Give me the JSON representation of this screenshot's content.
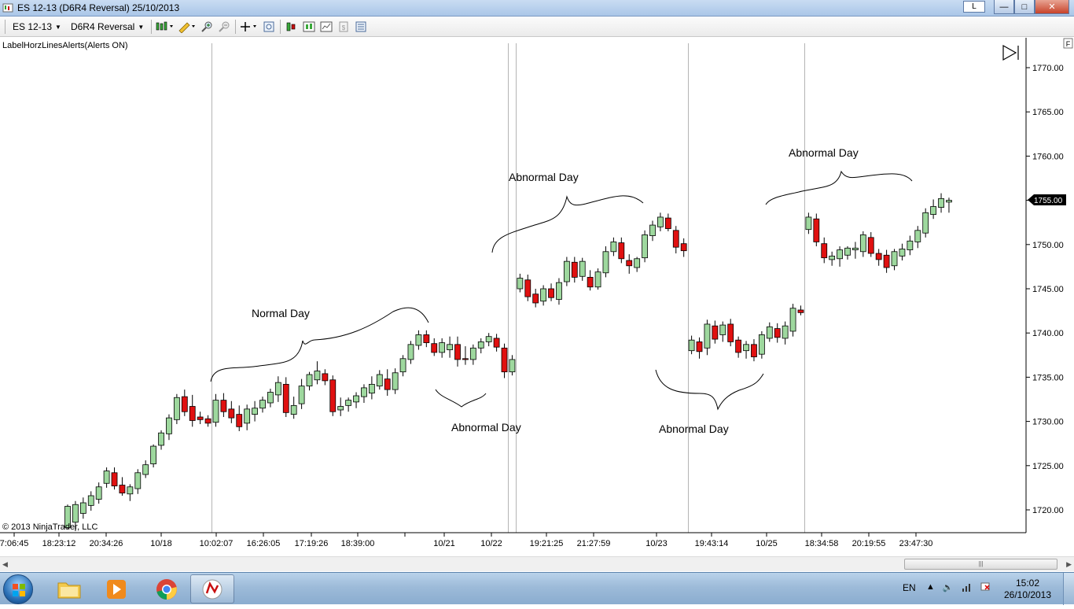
{
  "window": {
    "title": "ES 12-13 (D6R4 Reversal)  25/10/2013",
    "layout_label": "L",
    "buttons": {
      "minimize": "—",
      "maximize": "□",
      "close": "✕"
    }
  },
  "toolbar": {
    "instrument": "ES 12-13",
    "bar_type": "D6R4 Reversal"
  },
  "chart": {
    "indicator_label": "LabelHorzLinesAlerts(Alerts ON)",
    "copyright": "© 2013 NinjaTrader, LLC",
    "f_label": "F",
    "last_price_label": "1755.00",
    "annotations": {
      "normal_day": "Normal Day",
      "abnormal_1": "Abnormal Day",
      "abnormal_2": "Abnormal Day",
      "abnormal_3": "Abnormal Day",
      "abnormal_4": "Abnormal Day"
    }
  },
  "chart_data": {
    "type": "candlestick",
    "y_axis": {
      "labels": [
        "1770.00",
        "1765.00",
        "1760.00",
        "1755.00",
        "1750.00",
        "1745.00",
        "1740.00",
        "1735.00",
        "1730.00",
        "1725.00",
        "1720.00"
      ]
    },
    "x_axis": {
      "labels": [
        "7:06:45",
        "18:23:12",
        "20:34:26",
        "10/18",
        "10:02:07",
        "16:26:05",
        "17:19:26",
        "18:39:00",
        "10/21",
        "10/22",
        "19:21:25",
        "21:27:59",
        "10/23",
        "19:43:14",
        "10/25",
        "18:34:58",
        "20:19:55",
        "23:47:30"
      ]
    },
    "colors": {
      "up": "#9ed89e",
      "down": "#e01010",
      "wick": "#000000",
      "session_line": "#b4b4b4"
    },
    "candles": [
      {
        "o": 1718.0,
        "h": 1720.6,
        "l": 1717.8,
        "c": 1720.4
      },
      {
        "o": 1718.6,
        "h": 1721.0,
        "l": 1717.6,
        "c": 1720.6
      },
      {
        "o": 1719.6,
        "h": 1721.4,
        "l": 1719.0,
        "c": 1720.8
      },
      {
        "o": 1720.5,
        "h": 1722.1,
        "l": 1719.9,
        "c": 1721.6
      },
      {
        "o": 1721.2,
        "h": 1723.1,
        "l": 1720.7,
        "c": 1722.6
      },
      {
        "o": 1723.0,
        "h": 1724.8,
        "l": 1722.5,
        "c": 1724.4
      },
      {
        "o": 1724.2,
        "h": 1724.8,
        "l": 1722.3,
        "c": 1722.7
      },
      {
        "o": 1722.8,
        "h": 1723.7,
        "l": 1721.6,
        "c": 1721.9
      },
      {
        "o": 1721.8,
        "h": 1722.9,
        "l": 1721.0,
        "c": 1722.6
      },
      {
        "o": 1722.4,
        "h": 1724.6,
        "l": 1721.8,
        "c": 1724.2
      },
      {
        "o": 1724.0,
        "h": 1725.6,
        "l": 1723.6,
        "c": 1725.1
      },
      {
        "o": 1725.2,
        "h": 1727.4,
        "l": 1724.8,
        "c": 1727.2
      },
      {
        "o": 1727.3,
        "h": 1729.0,
        "l": 1726.8,
        "c": 1728.7
      },
      {
        "o": 1728.6,
        "h": 1730.8,
        "l": 1727.9,
        "c": 1730.4
      },
      {
        "o": 1730.2,
        "h": 1733.1,
        "l": 1729.7,
        "c": 1732.7
      },
      {
        "o": 1732.8,
        "h": 1733.6,
        "l": 1730.6,
        "c": 1731.1
      },
      {
        "o": 1731.7,
        "h": 1733.0,
        "l": 1729.4,
        "c": 1730.1
      },
      {
        "o": 1730.5,
        "h": 1731.1,
        "l": 1729.7,
        "c": 1730.2
      },
      {
        "o": 1730.3,
        "h": 1730.7,
        "l": 1729.4,
        "c": 1729.8
      },
      {
        "o": 1729.9,
        "h": 1733.1,
        "l": 1729.4,
        "c": 1732.4
      },
      {
        "o": 1732.4,
        "h": 1733.2,
        "l": 1730.5,
        "c": 1731.1
      },
      {
        "o": 1731.4,
        "h": 1732.3,
        "l": 1729.8,
        "c": 1730.4
      },
      {
        "o": 1730.8,
        "h": 1731.8,
        "l": 1728.9,
        "c": 1729.4
      },
      {
        "o": 1729.8,
        "h": 1731.9,
        "l": 1729.0,
        "c": 1731.4
      },
      {
        "o": 1730.8,
        "h": 1732.3,
        "l": 1730.0,
        "c": 1731.5
      },
      {
        "o": 1731.5,
        "h": 1732.8,
        "l": 1731.0,
        "c": 1732.4
      },
      {
        "o": 1732.1,
        "h": 1733.7,
        "l": 1731.6,
        "c": 1733.3
      },
      {
        "o": 1733.0,
        "h": 1735.1,
        "l": 1732.2,
        "c": 1734.4
      },
      {
        "o": 1734.2,
        "h": 1735.0,
        "l": 1730.5,
        "c": 1731.0
      },
      {
        "o": 1730.8,
        "h": 1732.8,
        "l": 1730.3,
        "c": 1731.8
      },
      {
        "o": 1732.0,
        "h": 1734.8,
        "l": 1731.4,
        "c": 1734.0
      },
      {
        "o": 1734.0,
        "h": 1735.6,
        "l": 1733.5,
        "c": 1735.3
      },
      {
        "o": 1734.7,
        "h": 1736.8,
        "l": 1734.2,
        "c": 1735.7
      },
      {
        "o": 1735.4,
        "h": 1735.9,
        "l": 1734.1,
        "c": 1734.6
      },
      {
        "o": 1734.7,
        "h": 1735.2,
        "l": 1730.6,
        "c": 1731.1
      },
      {
        "o": 1731.3,
        "h": 1732.7,
        "l": 1730.6,
        "c": 1731.7
      },
      {
        "o": 1731.8,
        "h": 1732.7,
        "l": 1731.1,
        "c": 1732.4
      },
      {
        "o": 1732.2,
        "h": 1733.3,
        "l": 1731.5,
        "c": 1732.9
      },
      {
        "o": 1732.8,
        "h": 1734.2,
        "l": 1732.1,
        "c": 1733.8
      },
      {
        "o": 1733.2,
        "h": 1735.1,
        "l": 1732.5,
        "c": 1734.2
      },
      {
        "o": 1734.0,
        "h": 1735.8,
        "l": 1733.6,
        "c": 1735.3
      },
      {
        "o": 1734.8,
        "h": 1735.9,
        "l": 1732.9,
        "c": 1733.6
      },
      {
        "o": 1733.6,
        "h": 1736.0,
        "l": 1733.1,
        "c": 1735.5
      },
      {
        "o": 1735.6,
        "h": 1737.5,
        "l": 1735.1,
        "c": 1737.1
      },
      {
        "o": 1737.0,
        "h": 1739.1,
        "l": 1736.5,
        "c": 1738.7
      },
      {
        "o": 1738.6,
        "h": 1740.3,
        "l": 1738.1,
        "c": 1739.8
      },
      {
        "o": 1739.8,
        "h": 1740.3,
        "l": 1738.4,
        "c": 1738.9
      },
      {
        "o": 1738.8,
        "h": 1739.4,
        "l": 1737.4,
        "c": 1737.8
      },
      {
        "o": 1737.8,
        "h": 1739.4,
        "l": 1737.2,
        "c": 1738.9
      },
      {
        "o": 1738.1,
        "h": 1739.6,
        "l": 1737.2,
        "c": 1738.7
      },
      {
        "o": 1738.7,
        "h": 1739.6,
        "l": 1736.2,
        "c": 1737.0
      },
      {
        "o": 1737.1,
        "h": 1738.5,
        "l": 1736.4,
        "c": 1737.0
      },
      {
        "o": 1737.0,
        "h": 1738.7,
        "l": 1736.4,
        "c": 1738.3
      },
      {
        "o": 1738.3,
        "h": 1739.4,
        "l": 1737.7,
        "c": 1739.0
      },
      {
        "o": 1739.0,
        "h": 1740.0,
        "l": 1738.5,
        "c": 1739.6
      },
      {
        "o": 1739.4,
        "h": 1739.9,
        "l": 1737.9,
        "c": 1738.4
      },
      {
        "o": 1738.3,
        "h": 1738.8,
        "l": 1734.9,
        "c": 1735.6
      },
      {
        "o": 1735.6,
        "h": 1737.5,
        "l": 1735.2,
        "c": 1737.0
      },
      {
        "o": 1745.0,
        "h": 1746.7,
        "l": 1744.6,
        "c": 1746.2
      },
      {
        "o": 1746.0,
        "h": 1746.6,
        "l": 1743.6,
        "c": 1744.1
      },
      {
        "o": 1744.4,
        "h": 1745.0,
        "l": 1742.9,
        "c": 1743.4
      },
      {
        "o": 1743.6,
        "h": 1745.4,
        "l": 1743.1,
        "c": 1745.0
      },
      {
        "o": 1745.0,
        "h": 1745.6,
        "l": 1743.6,
        "c": 1744.0
      },
      {
        "o": 1743.8,
        "h": 1746.2,
        "l": 1743.2,
        "c": 1745.7
      },
      {
        "o": 1745.8,
        "h": 1748.6,
        "l": 1745.3,
        "c": 1748.1
      },
      {
        "o": 1748.0,
        "h": 1748.6,
        "l": 1745.7,
        "c": 1746.3
      },
      {
        "o": 1746.4,
        "h": 1748.5,
        "l": 1745.9,
        "c": 1748.1
      },
      {
        "o": 1746.3,
        "h": 1747.1,
        "l": 1744.8,
        "c": 1745.2
      },
      {
        "o": 1745.2,
        "h": 1747.3,
        "l": 1744.9,
        "c": 1746.9
      },
      {
        "o": 1746.8,
        "h": 1749.8,
        "l": 1746.3,
        "c": 1749.2
      },
      {
        "o": 1749.2,
        "h": 1750.8,
        "l": 1748.7,
        "c": 1750.3
      },
      {
        "o": 1750.2,
        "h": 1750.8,
        "l": 1747.9,
        "c": 1748.4
      },
      {
        "o": 1748.2,
        "h": 1748.9,
        "l": 1746.7,
        "c": 1747.6
      },
      {
        "o": 1747.4,
        "h": 1748.6,
        "l": 1746.9,
        "c": 1748.4
      },
      {
        "o": 1748.5,
        "h": 1751.6,
        "l": 1748.0,
        "c": 1751.1
      },
      {
        "o": 1751.0,
        "h": 1752.7,
        "l": 1750.4,
        "c": 1752.2
      },
      {
        "o": 1752.0,
        "h": 1753.6,
        "l": 1751.5,
        "c": 1753.1
      },
      {
        "o": 1753.0,
        "h": 1753.5,
        "l": 1751.5,
        "c": 1751.8
      },
      {
        "o": 1751.6,
        "h": 1752.1,
        "l": 1749.0,
        "c": 1749.7
      },
      {
        "o": 1750.1,
        "h": 1750.7,
        "l": 1748.6,
        "c": 1749.3
      },
      {
        "o": 1738.0,
        "h": 1739.7,
        "l": 1737.6,
        "c": 1739.2
      },
      {
        "o": 1739.0,
        "h": 1739.5,
        "l": 1737.1,
        "c": 1737.9
      },
      {
        "o": 1738.3,
        "h": 1741.5,
        "l": 1737.5,
        "c": 1741.0
      },
      {
        "o": 1740.8,
        "h": 1741.4,
        "l": 1738.8,
        "c": 1739.3
      },
      {
        "o": 1739.8,
        "h": 1741.3,
        "l": 1739.0,
        "c": 1740.9
      },
      {
        "o": 1741.0,
        "h": 1741.6,
        "l": 1738.5,
        "c": 1739.0
      },
      {
        "o": 1739.2,
        "h": 1739.6,
        "l": 1737.2,
        "c": 1737.8
      },
      {
        "o": 1738.0,
        "h": 1739.1,
        "l": 1737.1,
        "c": 1738.7
      },
      {
        "o": 1738.7,
        "h": 1739.3,
        "l": 1736.8,
        "c": 1737.3
      },
      {
        "o": 1737.6,
        "h": 1740.2,
        "l": 1737.1,
        "c": 1739.8
      },
      {
        "o": 1739.4,
        "h": 1741.2,
        "l": 1739.0,
        "c": 1740.7
      },
      {
        "o": 1740.5,
        "h": 1741.1,
        "l": 1738.9,
        "c": 1739.5
      },
      {
        "o": 1739.4,
        "h": 1741.3,
        "l": 1738.7,
        "c": 1740.8
      },
      {
        "o": 1740.2,
        "h": 1743.3,
        "l": 1739.6,
        "c": 1742.8
      },
      {
        "o": 1742.6,
        "h": 1743.1,
        "l": 1742.0,
        "c": 1742.3
      },
      {
        "o": 1751.7,
        "h": 1753.6,
        "l": 1751.2,
        "c": 1753.1
      },
      {
        "o": 1752.9,
        "h": 1753.5,
        "l": 1749.8,
        "c": 1750.3
      },
      {
        "o": 1750.1,
        "h": 1750.8,
        "l": 1747.9,
        "c": 1748.5
      },
      {
        "o": 1748.3,
        "h": 1749.2,
        "l": 1747.6,
        "c": 1748.7
      },
      {
        "o": 1748.4,
        "h": 1749.8,
        "l": 1747.5,
        "c": 1749.4
      },
      {
        "o": 1748.8,
        "h": 1749.8,
        "l": 1748.3,
        "c": 1749.6
      },
      {
        "o": 1749.4,
        "h": 1750.3,
        "l": 1748.4,
        "c": 1749.6
      },
      {
        "o": 1749.2,
        "h": 1751.5,
        "l": 1748.6,
        "c": 1751.1
      },
      {
        "o": 1750.8,
        "h": 1751.4,
        "l": 1748.6,
        "c": 1749.0
      },
      {
        "o": 1749.0,
        "h": 1749.5,
        "l": 1747.6,
        "c": 1748.3
      },
      {
        "o": 1748.8,
        "h": 1749.4,
        "l": 1746.8,
        "c": 1747.4
      },
      {
        "o": 1747.6,
        "h": 1749.5,
        "l": 1747.1,
        "c": 1749.2
      },
      {
        "o": 1748.7,
        "h": 1750.1,
        "l": 1748.2,
        "c": 1749.5
      },
      {
        "o": 1749.4,
        "h": 1751.0,
        "l": 1748.8,
        "c": 1750.4
      },
      {
        "o": 1750.3,
        "h": 1752.1,
        "l": 1749.6,
        "c": 1751.6
      },
      {
        "o": 1751.3,
        "h": 1754.1,
        "l": 1750.8,
        "c": 1753.6
      },
      {
        "o": 1753.4,
        "h": 1755.1,
        "l": 1752.9,
        "c": 1754.3
      },
      {
        "o": 1754.2,
        "h": 1755.8,
        "l": 1753.6,
        "c": 1755.2
      },
      {
        "o": 1754.8,
        "h": 1755.3,
        "l": 1753.6,
        "c": 1755.0
      }
    ],
    "sessions_start_index": [
      19,
      57,
      58,
      80,
      95
    ]
  },
  "hscroll": {
    "left_arrow": "◀",
    "right_arrow": "▶",
    "thumb_grip": "|||"
  },
  "taskbar": {
    "language": "EN",
    "clock_time": "15:02",
    "clock_date": "26/10/2013"
  }
}
